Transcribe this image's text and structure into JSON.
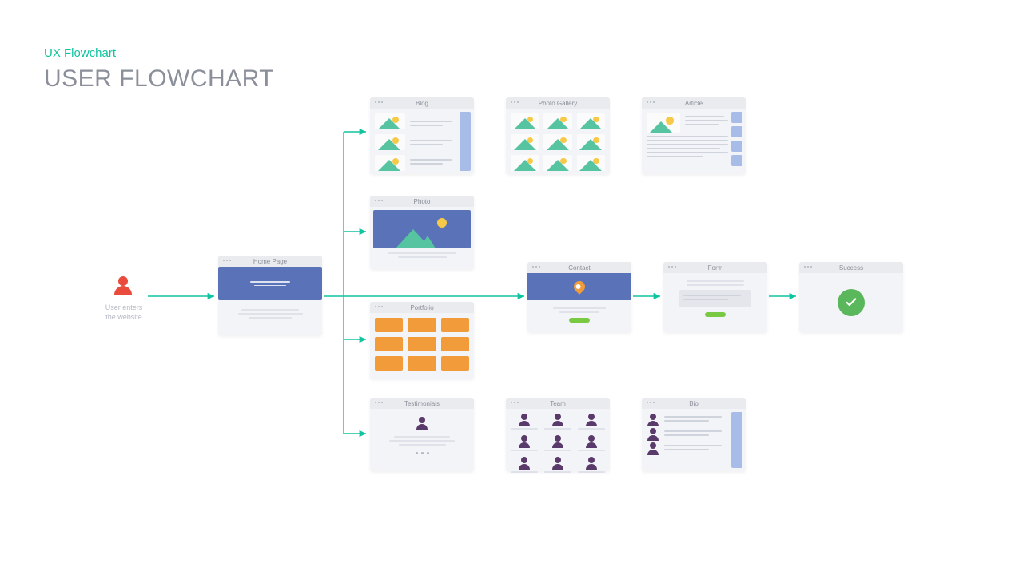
{
  "header": {
    "subtitle": "UX Flowchart",
    "title": "USER FLOWCHART"
  },
  "entry": {
    "caption_line1": "User enters",
    "caption_line2": "the website"
  },
  "nodes": {
    "home": {
      "label": "Home Page"
    },
    "blog": {
      "label": "Blog"
    },
    "gallery": {
      "label": "Photo Gallery"
    },
    "article": {
      "label": "Article"
    },
    "photo": {
      "label": "Photo"
    },
    "portfolio": {
      "label": "Portfolio"
    },
    "testimonials": {
      "label": "Testimonials"
    },
    "team": {
      "label": "Team"
    },
    "bio": {
      "label": "Bio"
    },
    "contact": {
      "label": "Contact"
    },
    "form": {
      "label": "Form"
    },
    "success": {
      "label": "Success"
    }
  },
  "flow_connections": [
    [
      "user-entry",
      "home"
    ],
    [
      "home",
      "blog"
    ],
    [
      "home",
      "photo"
    ],
    [
      "home",
      "portfolio"
    ],
    [
      "home",
      "testimonials"
    ],
    [
      "home",
      "contact"
    ],
    [
      "contact",
      "form"
    ],
    [
      "form",
      "success"
    ]
  ]
}
